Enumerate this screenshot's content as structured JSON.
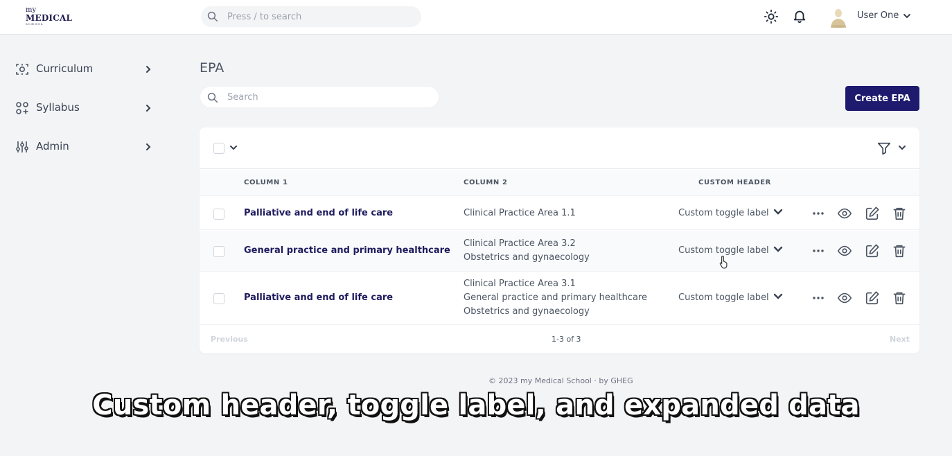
{
  "brand": {
    "logo_line1": "my",
    "logo_line2": "MEDICAL",
    "logo_line3": "SCHOOL"
  },
  "topbar": {
    "search_placeholder": "Press / to search",
    "user_name": "User One",
    "icons": [
      "search-icon",
      "sun-icon",
      "bell-icon",
      "avatar",
      "chevron-down-icon"
    ]
  },
  "sidebar": {
    "items": [
      {
        "label": "Curriculum",
        "icon": "curriculum-icon"
      },
      {
        "label": "Syllabus",
        "icon": "syllabus-icon"
      },
      {
        "label": "Admin",
        "icon": "sliders-icon"
      }
    ]
  },
  "main": {
    "title": "EPA",
    "search_placeholder": "Search",
    "create_button": "Create EPA"
  },
  "table": {
    "headers": [
      "COLUMN 1",
      "COLUMN 2",
      "CUSTOM HEADER"
    ],
    "rows": [
      {
        "title": "Palliative and end of life care",
        "col2": [
          "Clinical Practice Area 1.1"
        ],
        "toggle": "Custom toggle label"
      },
      {
        "title": "General practice and primary healthcare",
        "col2": [
          "Clinical Practice Area 3.2",
          "Obstetrics and gynaecology"
        ],
        "toggle": "Custom toggle label"
      },
      {
        "title": "Palliative and end of life care",
        "col2": [
          "Clinical Practice Area 3.1",
          "General practice and primary healthcare",
          "Obstetrics and gynaecology"
        ],
        "toggle": "Custom toggle label"
      }
    ],
    "row_actions": [
      "more-icon",
      "eye-icon",
      "edit-icon",
      "trash-icon"
    ]
  },
  "pagination": {
    "previous": "Previous",
    "info": "1-3 of 3",
    "next": "Next"
  },
  "footer": {
    "text": "© 2023 my Medical School · by GHEG"
  },
  "caption": {
    "text": "Custom header, toggle label, and expanded data"
  },
  "colors": {
    "primary": "#1e1b6e",
    "title_text": "#1e1b5e",
    "background": "#f3f4f6"
  }
}
